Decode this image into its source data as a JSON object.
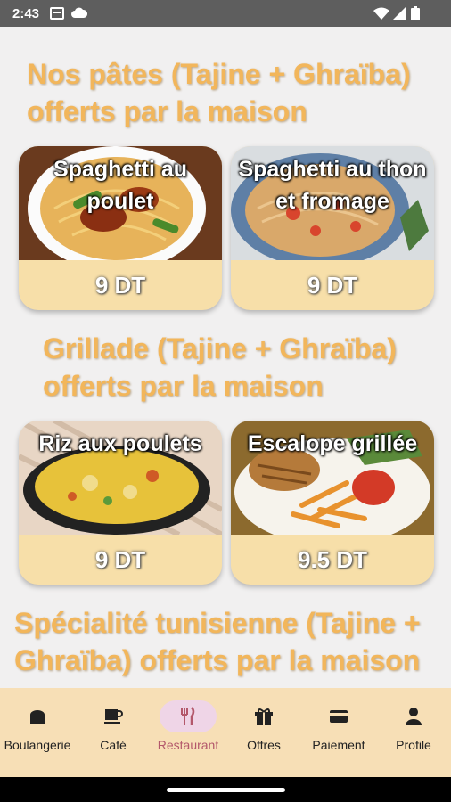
{
  "status_bar": {
    "time": "2:43"
  },
  "sections": [
    {
      "title": "Nos pâtes (Tajine + Ghraïba) offerts par la maison"
    },
    {
      "title": "Grillade (Tajine + Ghraïba) offerts par la maison"
    },
    {
      "title": "Spécialité tunisienne (Tajine + Ghraïba) offerts par la maison"
    }
  ],
  "dishes": [
    {
      "name": "Spaghetti au poulet",
      "price": "9 DT"
    },
    {
      "name": "Spaghetti au thon et fromage",
      "price": "9 DT"
    },
    {
      "name": "Riz aux poulets",
      "price": "9 DT"
    },
    {
      "name": "Escalope grillée",
      "price": "9.5 DT"
    }
  ],
  "nav": {
    "items": [
      {
        "label": "Boulangerie",
        "icon": "bread-icon"
      },
      {
        "label": "Café",
        "icon": "coffee-icon"
      },
      {
        "label": "Restaurant",
        "icon": "restaurant-icon",
        "active": true
      },
      {
        "label": "Offres",
        "icon": "gift-icon"
      },
      {
        "label": "Paiement",
        "icon": "card-icon"
      },
      {
        "label": "Profile",
        "icon": "person-icon"
      }
    ],
    "active_color": "#b3586b",
    "background": "#f7dfb6"
  },
  "colors": {
    "title": "#f2b65b",
    "card_footer": "#f7dfa9",
    "status_bar": "#5e5e5e"
  }
}
